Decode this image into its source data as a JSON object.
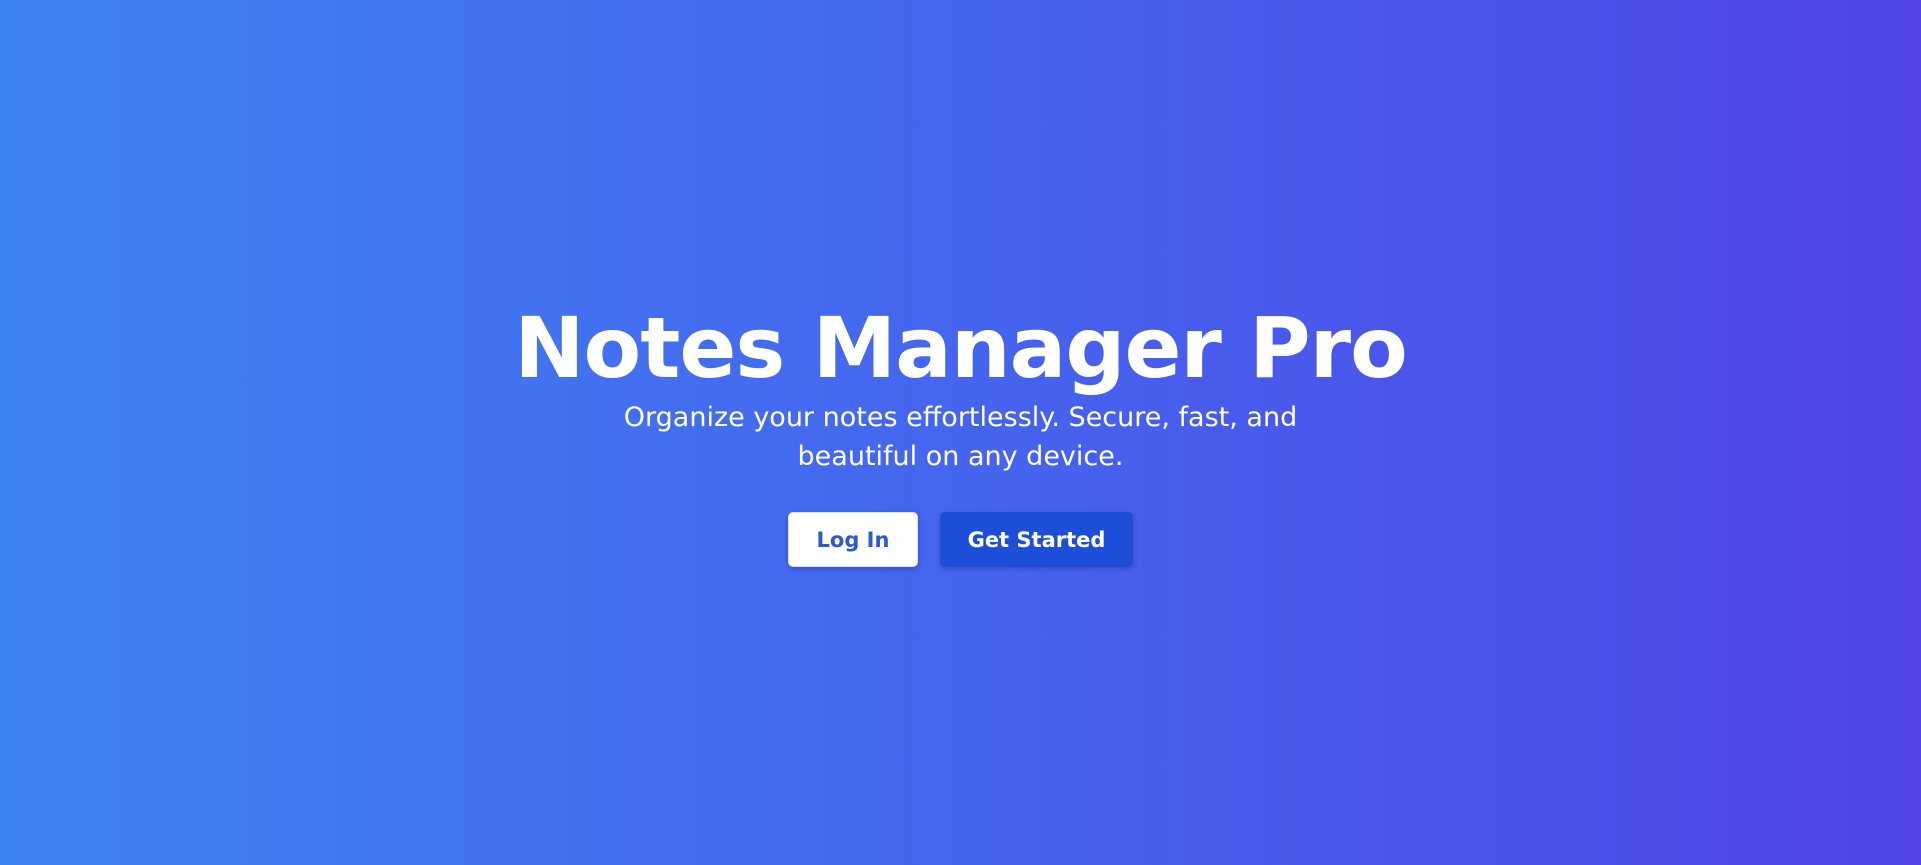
{
  "hero": {
    "title": "Notes Manager Pro",
    "subtitle_lines": [
      "Organize your notes effortlessly. Secure, fast, and",
      "beautiful on any device."
    ]
  },
  "actions": {
    "login_label": "Log In",
    "get_started_label": "Get Started"
  },
  "colors": {
    "background_start": "#3e83f3",
    "background_end": "#5044e6",
    "primary_button": "#1d4ed8",
    "login_text": "#2b59d1"
  }
}
